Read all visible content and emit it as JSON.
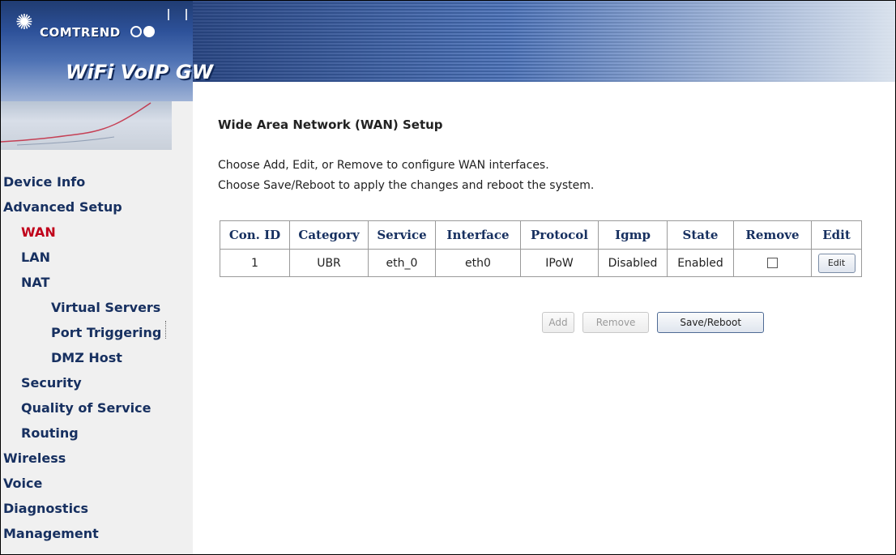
{
  "banner": {
    "brand": "COMTREND",
    "product": "WiFi VoIP GW"
  },
  "sidebar": {
    "items": [
      {
        "label": "Device Info",
        "level": 0,
        "active": false
      },
      {
        "label": "Advanced Setup",
        "level": 0,
        "active": false
      },
      {
        "label": "WAN",
        "level": 1,
        "active": true
      },
      {
        "label": "LAN",
        "level": 1,
        "active": false
      },
      {
        "label": "NAT",
        "level": 1,
        "active": false
      },
      {
        "label": "Virtual Servers",
        "level": 2,
        "active": false
      },
      {
        "label": "Port Triggering",
        "level": 2,
        "active": false
      },
      {
        "label": "DMZ Host",
        "level": 2,
        "active": false
      },
      {
        "label": "Security",
        "level": 1,
        "active": false
      },
      {
        "label": "Quality of Service",
        "level": 1,
        "active": false
      },
      {
        "label": "Routing",
        "level": 1,
        "active": false
      },
      {
        "label": "Wireless",
        "level": 0,
        "active": false
      },
      {
        "label": "Voice",
        "level": 0,
        "active": false
      },
      {
        "label": "Diagnostics",
        "level": 0,
        "active": false
      },
      {
        "label": "Management",
        "level": 0,
        "active": false
      }
    ]
  },
  "main": {
    "title": "Wide Area Network (WAN) Setup",
    "description_line1": "Choose Add, Edit, or Remove to configure WAN interfaces.",
    "description_line2": "Choose Save/Reboot to apply the changes and reboot the system.",
    "table": {
      "headers": [
        "Con. ID",
        "Category",
        "Service",
        "Interface",
        "Protocol",
        "Igmp",
        "State",
        "Remove",
        "Edit"
      ],
      "rows": [
        {
          "con_id": "1",
          "category": "UBR",
          "service": "eth_0",
          "interface": "eth0",
          "protocol": "IPoW",
          "igmp": "Disabled",
          "state": "Enabled",
          "remove_checked": false,
          "edit_label": "Edit"
        }
      ]
    },
    "buttons": {
      "add": "Add",
      "remove": "Remove",
      "save_reboot": "Save/Reboot"
    }
  },
  "colors": {
    "nav_text": "#173060",
    "nav_active": "#c0001a",
    "sidebar_bg": "#f0f0f0",
    "banner_blue": "#2d5199"
  }
}
